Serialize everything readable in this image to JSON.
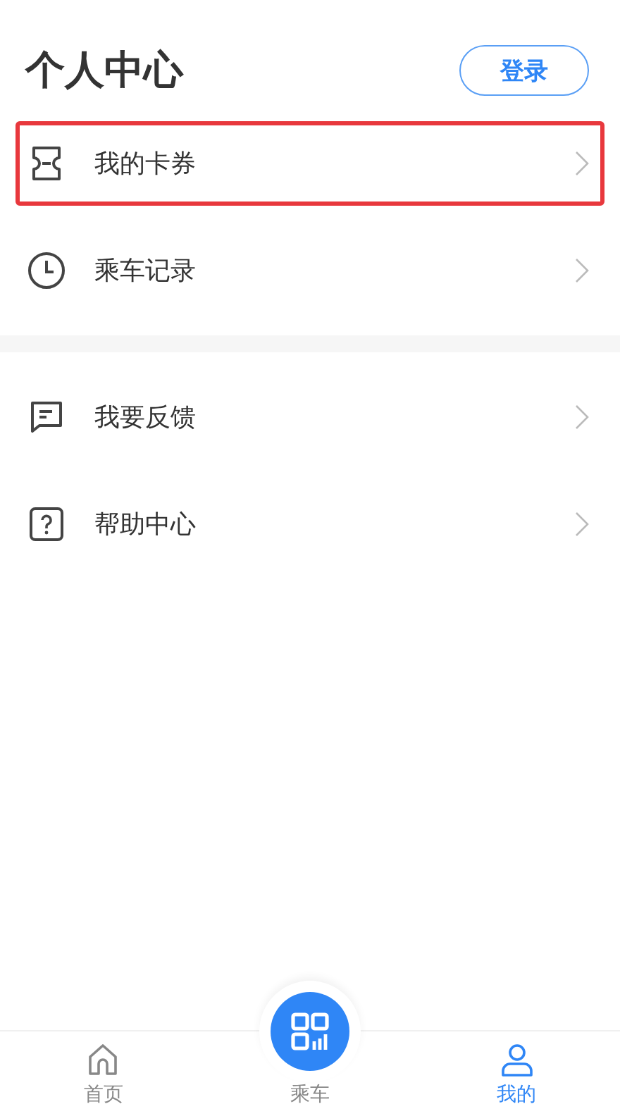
{
  "header": {
    "title": "个人中心",
    "login_button": "登录"
  },
  "sections": [
    {
      "items": [
        {
          "kind": "ticket",
          "label": "我的卡券",
          "highlighted": true
        },
        {
          "kind": "clock",
          "label": "乘车记录",
          "highlighted": false
        }
      ]
    },
    {
      "items": [
        {
          "kind": "message",
          "label": "我要反馈",
          "highlighted": false
        },
        {
          "kind": "help",
          "label": "帮助中心",
          "highlighted": false
        }
      ]
    }
  ],
  "tab_bar": [
    {
      "kind": "home",
      "label": "首页",
      "selected": false
    },
    {
      "kind": "qr",
      "label": "乘车",
      "selected": false
    },
    {
      "kind": "user",
      "label": "我的",
      "selected": true
    }
  ]
}
